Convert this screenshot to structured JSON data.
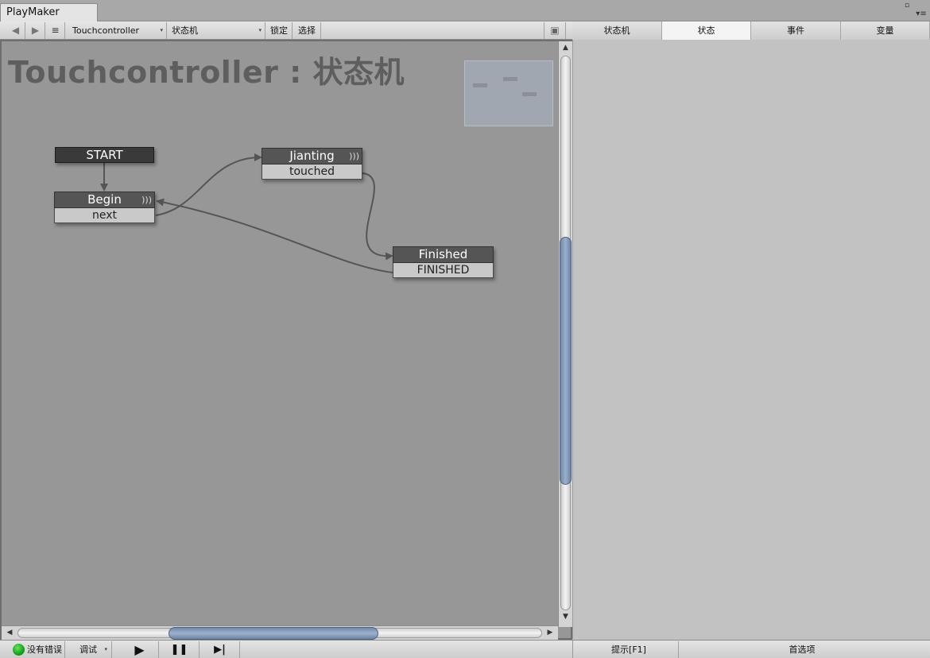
{
  "window": {
    "tab_title": "PlayMaker",
    "maximize_glyph": "▫",
    "menu_glyph": "▾≡"
  },
  "toolbar": {
    "back_icon": "◀",
    "forward_icon": "▶",
    "menu_icon": "≡",
    "gameobject_select": "Touchcontroller",
    "fsm_select": "状态机",
    "lock_label": "锁定",
    "select_label": "选择",
    "graph_view_icon": "▣",
    "dropdown_arrow": "▾"
  },
  "inspector_tabs": [
    {
      "label": "状态机",
      "active": false
    },
    {
      "label": "状态",
      "active": true
    },
    {
      "label": "事件",
      "active": false
    },
    {
      "label": "变量",
      "active": false
    }
  ],
  "graph": {
    "title": "Touchcontroller : 状态机",
    "start_label": "START",
    "states": [
      {
        "name": "Begin",
        "transition": "next"
      },
      {
        "name": "Jianting",
        "transition": "touched"
      },
      {
        "name": "Finished",
        "transition": "FINISHED"
      }
    ],
    "state_glyph": ")))",
    "colors": {
      "canvas": "#979797",
      "node_header": "#555555",
      "node_transition": "#c9c9c9",
      "link": "#555555",
      "scroll_thumb": "#8fa3c0"
    }
  },
  "bottom": {
    "status_text": "没有错误",
    "debug_label": "调试",
    "play_icon": "▶",
    "pause_icon": "❚❚",
    "step_icon": "▶|",
    "hints_label": "提示[F1]",
    "preferences_label": "首选项"
  },
  "scroll": {
    "up": "▲",
    "down": "▼",
    "left": "◀",
    "right": "▶"
  }
}
